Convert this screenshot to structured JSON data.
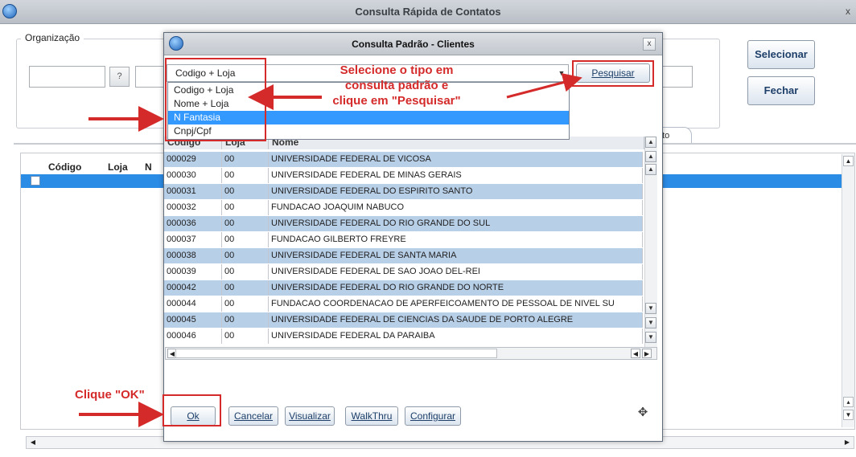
{
  "main": {
    "title": "Consulta Rápida de Contatos",
    "close_glyph": "x",
    "group_label": "Organização",
    "help_button": "?",
    "select_button": "Selecionar",
    "close_button": "Fechar",
    "tab_fragment": "nto",
    "grid_headers": [
      "Código",
      "Loja",
      "N"
    ]
  },
  "dialog": {
    "title": "Consulta Padrão - Clientes",
    "close_glyph": "x",
    "combo_value": "Codigo + Loja",
    "dropdown_options": [
      "Codigo + Loja",
      "Nome + Loja",
      "N Fantasia",
      "Cnpj/Cpf"
    ],
    "selected_option_index": 2,
    "search_button": "Pesquisar",
    "table": {
      "headers": [
        "Codigo",
        "Loja",
        "Nome"
      ],
      "rows": [
        [
          "000029",
          "00",
          "UNIVERSIDADE FEDERAL DE VICOSA"
        ],
        [
          "000030",
          "00",
          "UNIVERSIDADE FEDERAL DE MINAS GERAIS"
        ],
        [
          "000031",
          "00",
          "UNIVERSIDADE FEDERAL DO ESPIRITO SANTO"
        ],
        [
          "000032",
          "00",
          "FUNDACAO JOAQUIM NABUCO"
        ],
        [
          "000036",
          "00",
          "UNIVERSIDADE FEDERAL DO RIO GRANDE DO SUL"
        ],
        [
          "000037",
          "00",
          "FUNDACAO GILBERTO FREYRE"
        ],
        [
          "000038",
          "00",
          "UNIVERSIDADE FEDERAL DE SANTA MARIA"
        ],
        [
          "000039",
          "00",
          "UNIVERSIDADE FEDERAL DE SAO JOAO DEL-REI"
        ],
        [
          "000042",
          "00",
          "UNIVERSIDADE FEDERAL DO RIO GRANDE DO NORTE"
        ],
        [
          "000044",
          "00",
          "FUNDACAO COORDENACAO DE APERFEICOAMENTO DE PESSOAL DE NIVEL SU"
        ],
        [
          "000045",
          "00",
          "UNIVERSIDADE FEDERAL DE CIENCIAS DA SAUDE DE PORTO ALEGRE"
        ],
        [
          "000046",
          "00",
          "UNIVERSIDADE FEDERAL DA PARAIBA"
        ]
      ]
    },
    "buttons": {
      "ok": "Ok",
      "cancel": "Cancelar",
      "view": "Visualizar",
      "walkthru": "WalkThru",
      "configure": "Configurar"
    }
  },
  "annotations": {
    "instruction_lines": [
      "Selecione o tipo em",
      "consulta padrão e",
      "clique em \"Pesquisar\""
    ],
    "ok_hint": "Clique \"OK\"",
    "color": "#d42a2a"
  },
  "colors": {
    "row_alt": "#b8cfe8",
    "selection": "#3399ff",
    "grid_selection": "#2b8ce6"
  }
}
